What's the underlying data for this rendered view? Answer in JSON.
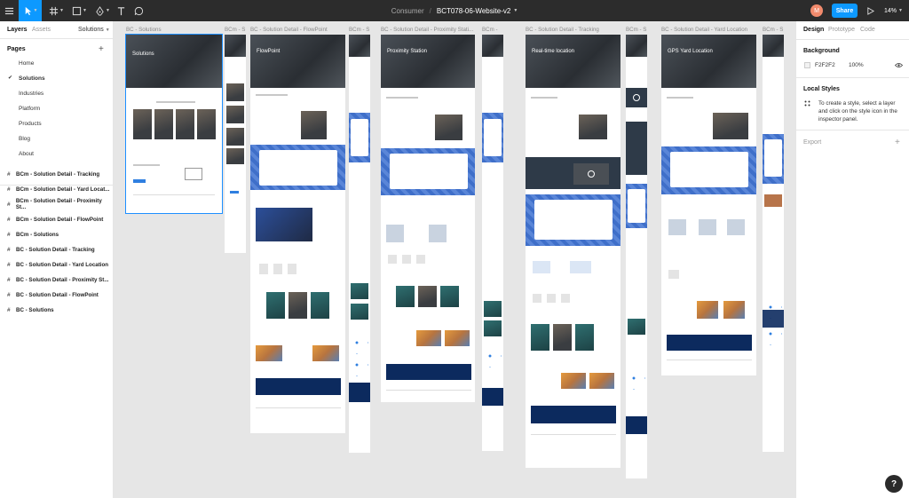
{
  "toolbar": {
    "project": "Consumer",
    "separator": "/",
    "file_name": "BCT078-06-Website-v2",
    "avatar_initial": "M",
    "share_label": "Share",
    "zoom": "14%"
  },
  "left_panel": {
    "tab_layers": "Layers",
    "tab_assets": "Assets",
    "current_page": "Solutions",
    "pages_label": "Pages",
    "pages": [
      "Home",
      "Solutions",
      "Industries",
      "Platform",
      "Products",
      "Blog",
      "About"
    ],
    "active_page": "Solutions",
    "layers": [
      "BCm - Solution Detail - Tracking",
      "BCm - Solution Detail - Yard Locat...",
      "BCm - Solution Detail - Proximity St...",
      "BCm - Solution Detail - FlowPoint",
      "BCm - Solutions",
      "BC - Solution Detail - Tracking",
      "BC - Solution Detail - Yard Location",
      "BC - Solution Detail - Proximity St...",
      "BC - Solution Detail - FlowPoint",
      "BC - Solutions"
    ]
  },
  "right_panel": {
    "tab_design": "Design",
    "tab_prototype": "Prototype",
    "tab_code": "Code",
    "background_label": "Background",
    "background_hex": "F2F2F2",
    "background_opacity": "100%",
    "local_styles_label": "Local Styles",
    "local_styles_help": "To create a style, select a layer and click on the style icon in the inspector panel.",
    "export_label": "Export"
  },
  "canvas": {
    "frames": [
      {
        "label": "BC - Solutions",
        "hero_title": "Solutions"
      },
      {
        "label": "BCm - S"
      },
      {
        "label": "BC - Solution Detail - FlowPoint",
        "hero_title": "FlowPoint"
      },
      {
        "label": "BCm - S"
      },
      {
        "label": "BC - Solution Detail - Proximity Stati...",
        "hero_title": "Proximity Station"
      },
      {
        "label": "BCm -"
      },
      {
        "label": "BC - Solution Detail - Tracking",
        "hero_title": "Real-time location"
      },
      {
        "label": "BCm - S"
      },
      {
        "label": "BC - Solution Detail - Yard Location",
        "hero_title": "GPS Yard Location"
      },
      {
        "label": "BCm - S"
      }
    ]
  },
  "colors": {
    "accent": "#0d99ff",
    "toolbar_bg": "#2c2c2c",
    "canvas_bg": "#e6e6e6",
    "brand_blue": "#2f7fe0",
    "navy": "#0c2a5e"
  },
  "help_label": "?"
}
